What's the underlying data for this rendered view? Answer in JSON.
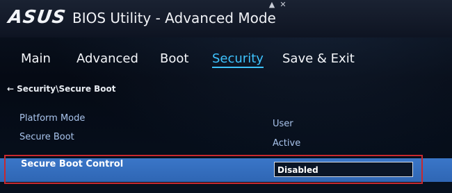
{
  "header": {
    "logo": "ASUS",
    "title": "BIOS Utility - Advanced Mode",
    "icons": [
      "arrow-icon",
      "close-icon"
    ]
  },
  "tabs": [
    {
      "label": "Main"
    },
    {
      "label": "Advanced"
    },
    {
      "label": "Boot"
    },
    {
      "label": "Security",
      "active": true
    },
    {
      "label": "Save & Exit"
    }
  ],
  "breadcrumb": {
    "arrow": "←",
    "label": "Security\\Secure Boot"
  },
  "settings": [
    {
      "label": "Platform Mode",
      "value": "User"
    },
    {
      "label": "Secure Boot",
      "value": "Active"
    }
  ],
  "selected": {
    "label": "Secure Boot Control",
    "value": "Disabled"
  },
  "colors": {
    "active_tab": "#3ec3ff",
    "selected_row": "#3a76c8",
    "highlight_frame": "#c8282e",
    "setting_text": "#a9c4ec"
  }
}
